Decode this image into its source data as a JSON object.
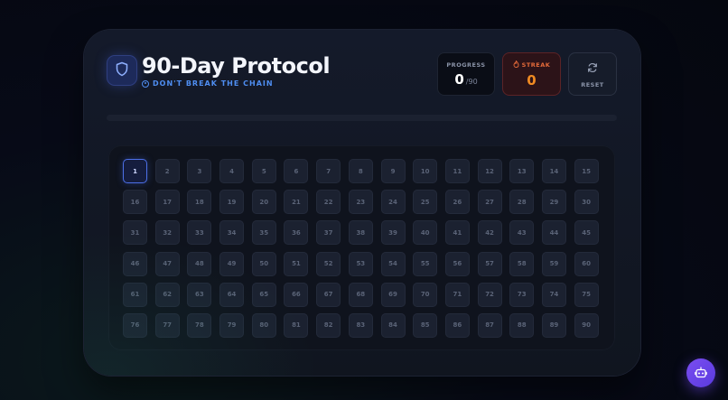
{
  "header": {
    "title": "90-Day Protocol",
    "subtitle": "DON'T BREAK THE CHAIN",
    "logo_icon": "shield-icon",
    "subtitle_icon": "target-icon"
  },
  "stats": {
    "progress": {
      "label": "PROGRESS",
      "value": "0",
      "total": "/90"
    },
    "streak": {
      "label": "STREAK",
      "value": "0",
      "icon": "flame-icon"
    },
    "reset": {
      "label": "RESET",
      "icon": "refresh-icon"
    }
  },
  "progress_bar": {
    "fraction": 0
  },
  "calendar": {
    "total_days": 90,
    "current_day": 1
  },
  "assistant_button": {
    "icon": "robot-icon"
  },
  "colors": {
    "accent": "#4f8ef2",
    "streak": "#f08a22",
    "fab": "#6a44ea"
  }
}
